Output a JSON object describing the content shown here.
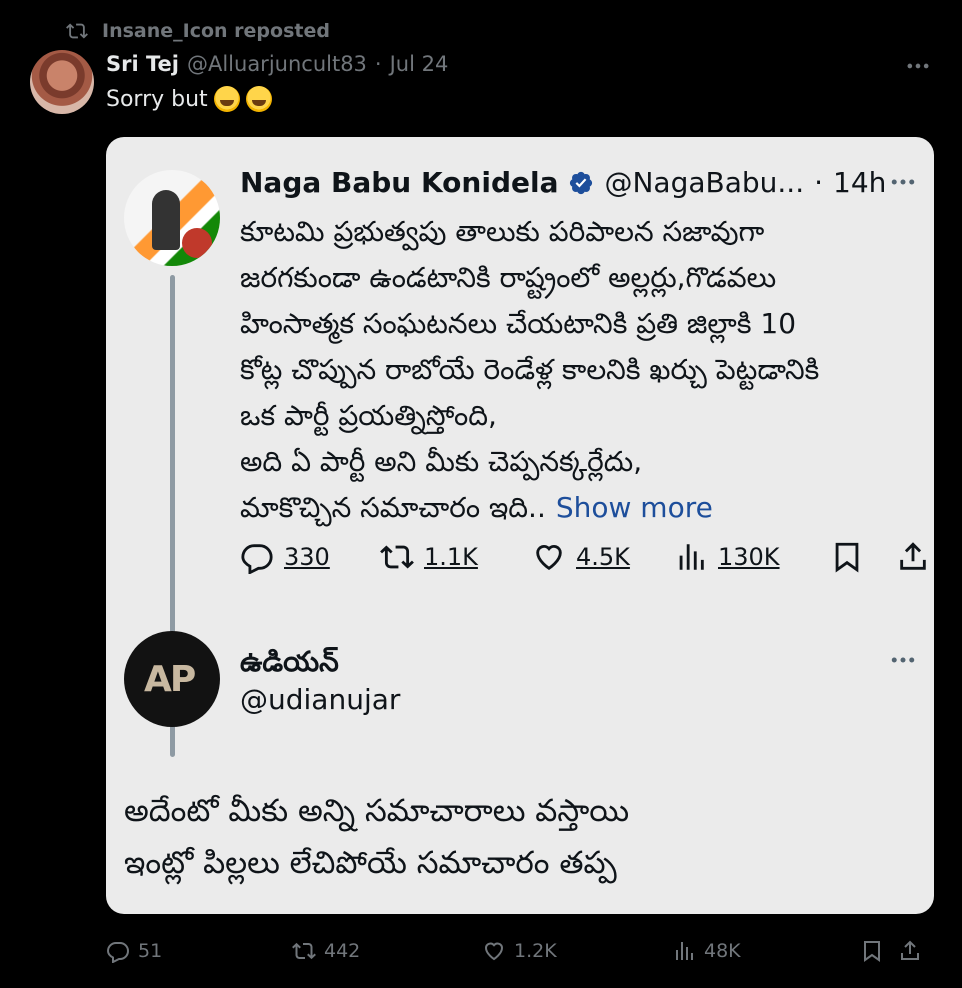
{
  "repost": {
    "label": "Insane_Icon reposted"
  },
  "tweet": {
    "author_name": "Sri Tej",
    "author_handle": "@Alluarjuncult83",
    "separator": "·",
    "date": "Jul 24",
    "text": "Sorry but",
    "more_icon": "more-horizontal-icon"
  },
  "quoted_image": {
    "author_name": "Naga Babu Konidela",
    "author_handle": "@NagaBabu...",
    "separator": "·",
    "time": "14h",
    "body_lines": [
      "కూటమి ప్రభుత్వపు తాలుకు  పరిపాలన సజావుగా",
      "జరగకుండా ఉండటానికి రాష్ట్రంలో అల్లర్లు,గొడవలు",
      "హింసాత్మక సంఘటనలు చేయటానికి ప్రతి జిల్లాకి 10",
      "కోట్ల చొప్పున రాబోయే రెండేళ్ల కాలనికి ఖర్చు పెట్టడానికి",
      "ఒక పార్టీ ప్రయత్నిస్తోంది,",
      "అది ఏ పార్టీ అని మీకు చెప్పనక్కర్లేదు,",
      "మాకొచ్చిన సమాచారం ఇది.."
    ],
    "show_more": "Show more",
    "stats": {
      "replies": "330",
      "reposts": "1.1K",
      "likes": "4.5K",
      "views": "130K"
    },
    "reply": {
      "author_name": "ఉడియన్",
      "author_handle": "@udianujar",
      "avatar_text": "AP",
      "body_lines": [
        "అదేంటో మీకు అన్ని సమాచారాలు వస్తాయి",
        "ఇంట్లో పిల్లలు లేచిపోయే సమాచారం తప్ప"
      ]
    }
  },
  "actions": {
    "replies": "51",
    "reposts": "442",
    "likes": "1.2K",
    "views": "48K"
  },
  "colors": {
    "background": "#000000",
    "muted": "#71767b",
    "card": "#ebebeb",
    "link": "#1d4e9b",
    "verified": "#1d9bf0"
  }
}
